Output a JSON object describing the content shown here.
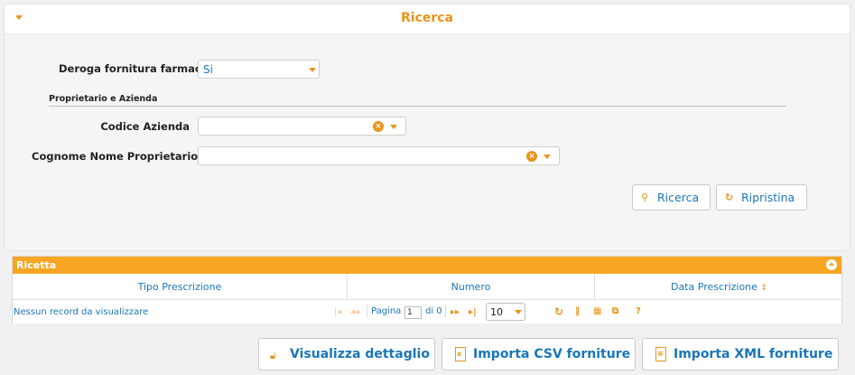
{
  "search": {
    "title": "Ricerca",
    "deroga_label": "Deroga fornitura farmaci",
    "deroga_value": "Si",
    "section_label": "Proprietario e Azienda",
    "codice_label": "Codice Azienda",
    "codice_value": "",
    "cognome_label": "Cognome Nome Proprietario",
    "cognome_value": "",
    "search_button": "Ricerca",
    "reset_button": "Ripristina"
  },
  "grid": {
    "title": "Ricetta",
    "columns": [
      "Tipo Prescrizione",
      "Numero",
      "Data Prescrizione"
    ],
    "empty_text": "Nessun record da visualizzare",
    "page_label": "Pagina",
    "page_value": "1",
    "of_label": "di 0",
    "rows_per_page": "10"
  },
  "actions": {
    "details": "Visualizza dettaglio",
    "import_csv": "Importa CSV forniture",
    "import_xml": "Importa XML forniture"
  },
  "colors": {
    "accent": "#e8951a",
    "header_bar": "#f6a623",
    "link": "#1a76b8"
  }
}
